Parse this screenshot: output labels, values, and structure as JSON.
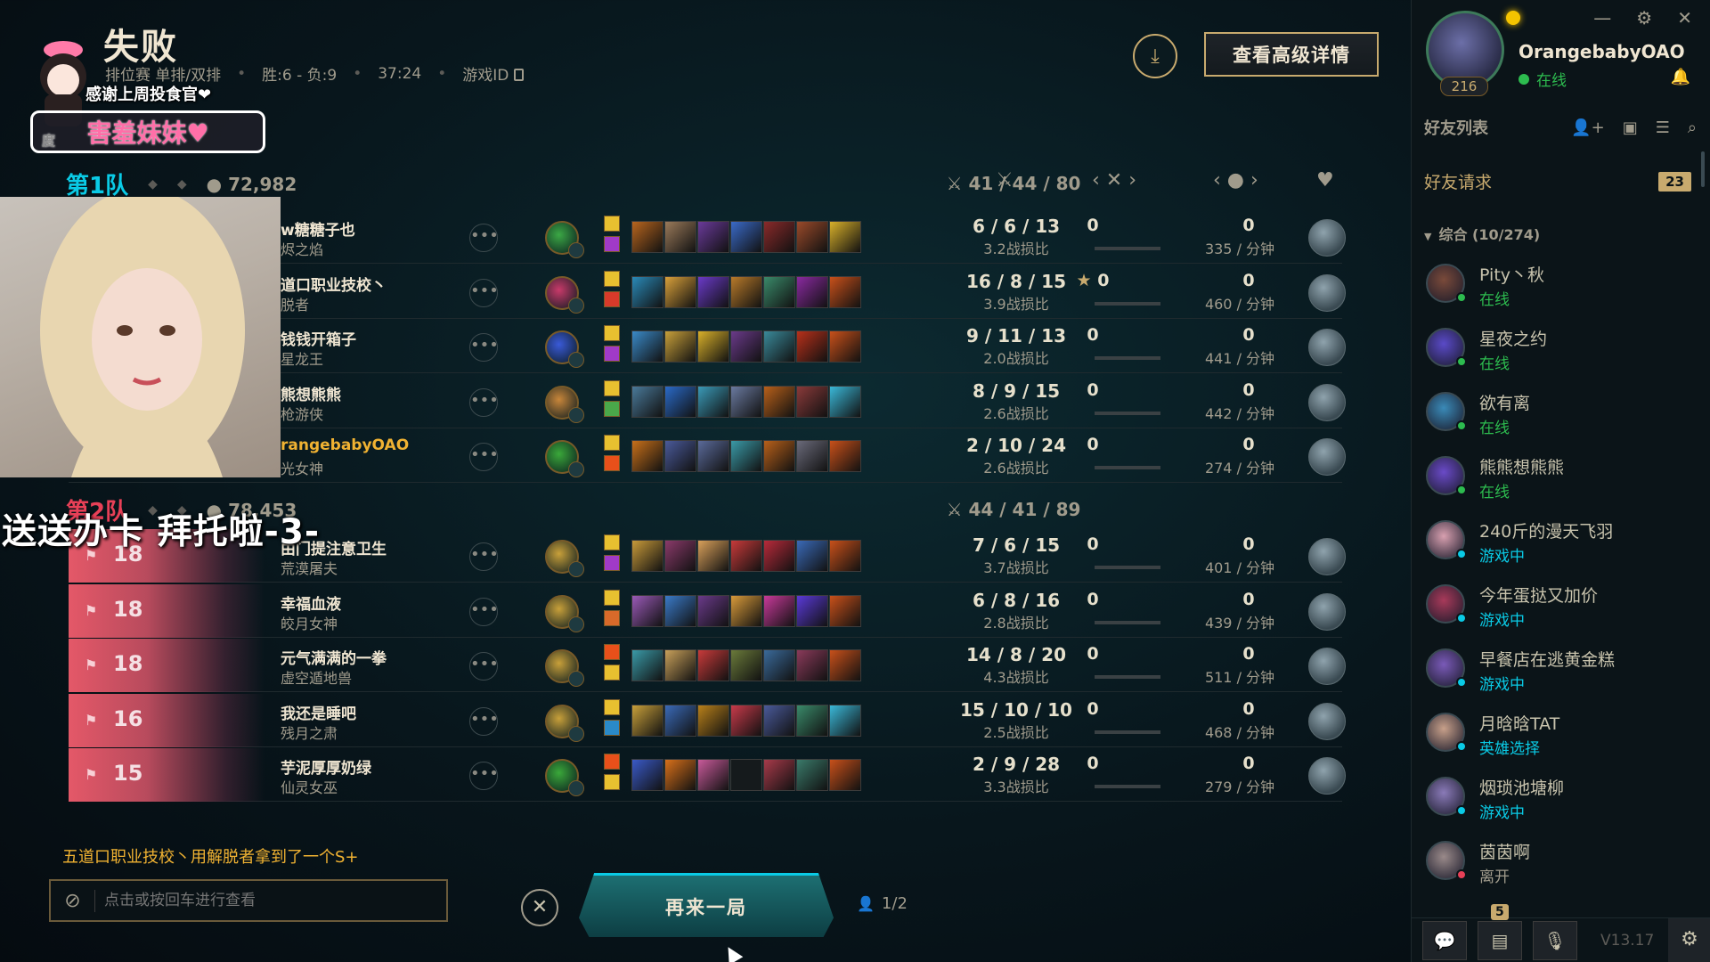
{
  "header": {
    "result": "失败",
    "mode": "排位赛 单排/双排",
    "record": "胜:6 - 负:9",
    "duration": "37:24",
    "game_id_label": "游戏ID",
    "advanced_button": "查看高级详情"
  },
  "overlay": {
    "thanks": "感谢上周投食官❤",
    "sister": "害羞妹妹♥",
    "sister_small": "度",
    "send_text": "送送办卡 拜托啦-3-"
  },
  "team1": {
    "name": "第1队",
    "kda": "41 / 44 / 80",
    "gold": "72,982",
    "players": [
      {
        "name": "w糖糖子也",
        "champ": "烬之焰",
        "kda": "6 / 6 / 13",
        "ratio": "3.2战损比",
        "score": "0",
        "star": "",
        "gold": "0",
        "gpm": "335 / 分钟",
        "me": false,
        "champ_color": "#3ba845",
        "items": [
          "#b8651e",
          "#9a7a5a",
          "#6a3a9a",
          "#3a6ac8",
          "#8a2a2a",
          "#9a4a2a",
          "#d8b02a"
        ],
        "spells": [
          "#e8c030",
          "#a03ac8"
        ]
      },
      {
        "name": "道口职业技校丶",
        "champ": "脱者",
        "kda": "16 / 8 / 15",
        "ratio": "3.9战损比",
        "score": "0",
        "star": "★",
        "gold": "0",
        "gpm": "460 / 分钟",
        "me": false,
        "champ_color": "#c83a6a",
        "items": [
          "#2a8ab8",
          "#d8a03a",
          "#6a3ac8",
          "#b87a2a",
          "#3a8a6a",
          "#8a2aa0",
          "#c8501a"
        ],
        "spells": [
          "#e8c030",
          "#d83a2a"
        ]
      },
      {
        "name": "钱钱开箱子",
        "champ": "星龙王",
        "kda": "9 / 11 / 13",
        "ratio": "2.0战损比",
        "score": "0",
        "star": "",
        "gold": "0",
        "gpm": "441 / 分钟",
        "me": false,
        "champ_color": "#3a5ad8",
        "items": [
          "#3a8ac8",
          "#c8a03a",
          "#d8b02a",
          "#6a3a8a",
          "#3a8a9a",
          "#b8301a",
          "#c8501a"
        ],
        "spells": [
          "#e8c030",
          "#a03ac8"
        ]
      },
      {
        "name": "熊想熊熊",
        "champ": "枪游侠",
        "kda": "8 / 9 / 15",
        "ratio": "2.6战损比",
        "score": "0",
        "star": "",
        "gold": "0",
        "gpm": "442 / 分钟",
        "me": false,
        "champ_color": "#c8863a",
        "items": [
          "#4a7a9a",
          "#2a6ac8",
          "#3a9ab8",
          "#6a7aa0",
          "#b8601a",
          "#8a3a3a",
          "#3ab8d8"
        ],
        "spells": [
          "#e8c030",
          "#4aa84a"
        ]
      },
      {
        "name": "rangebabyOAO",
        "champ": "光女神",
        "kda": "2 / 10 / 24",
        "ratio": "2.6战损比",
        "score": "0",
        "star": "",
        "gold": "0",
        "gpm": "274 / 分钟",
        "me": true,
        "champ_color": "#3aa83a",
        "items": [
          "#c8701a",
          "#4a5a9a",
          "#5a6a9a",
          "#3a9aa8",
          "#b8601a",
          "#6a6a7a",
          "#c8501a"
        ],
        "spells": [
          "#e8c030",
          "#e8501a"
        ]
      }
    ]
  },
  "team2": {
    "name": "第2队",
    "kda": "44 / 41 / 89",
    "gold": "78,453",
    "players": [
      {
        "name": "由门提注意卫生",
        "champ": "荒漠屠夫",
        "level": "18",
        "kda": "7 / 6 / 15",
        "ratio": "3.7战损比",
        "score": "0",
        "gold": "0",
        "gpm": "401 / 分钟",
        "champ_color": "#c8a03a",
        "items": [
          "#c89a3a",
          "#8a3a6a",
          "#d8a05a",
          "#c83a3a",
          "#b82a3a",
          "#3a6ab8",
          "#c8501a"
        ],
        "spells": [
          "#e8c030",
          "#a03ac8"
        ]
      },
      {
        "name": "幸福血液",
        "champ": "皎月女神",
        "level": "18",
        "kda": "6 / 8 / 16",
        "ratio": "2.8战损比",
        "score": "0",
        "gold": "0",
        "gpm": "439 / 分钟",
        "champ_color": "#c8a03a",
        "items": [
          "#9a5ab8",
          "#3a7ac8",
          "#6a3a8a",
          "#d89a3a",
          "#c83a9a",
          "#5a3ad8",
          "#c8501a"
        ],
        "spells": [
          "#e8c030",
          "#d86a2a"
        ]
      },
      {
        "name": "元气满满的一拳",
        "champ": "虚空遁地兽",
        "level": "18",
        "kda": "14 / 8 / 20",
        "ratio": "4.3战损比",
        "score": "0",
        "gold": "0",
        "gpm": "511 / 分钟",
        "champ_color": "#c8a03a",
        "items": [
          "#3a9aa8",
          "#c8a05a",
          "#c83a3a",
          "#6a7a3a",
          "#3a6a9a",
          "#8a3a5a",
          "#c8501a"
        ],
        "spells": [
          "#e8501a",
          "#e8c030"
        ]
      },
      {
        "name": "我还是睡吧",
        "champ": "残月之肃",
        "level": "16",
        "kda": "15 / 10 / 10",
        "ratio": "2.5战损比",
        "score": "0",
        "gold": "0",
        "gpm": "468 / 分钟",
        "champ_color": "#c8a03a",
        "items": [
          "#c8a03a",
          "#3a6ab8",
          "#b8801a",
          "#c83a4a",
          "#4a5a9a",
          "#3a8a6a",
          "#3ab8d8"
        ],
        "spells": [
          "#e8c030",
          "#2a8ac8"
        ]
      },
      {
        "name": "芋泥厚厚奶绿",
        "champ": "仙灵女巫",
        "level": "15",
        "kda": "2 / 9 / 28",
        "ratio": "3.3战损比",
        "score": "0",
        "gold": "0",
        "gpm": "279 / 分钟",
        "champ_color": "#3aa83a",
        "items": [
          "#3a5ac8",
          "#d8701a",
          "#c85a9a",
          "",
          "#a83a4a",
          "#3a7a6a",
          "#c8501a"
        ],
        "spells": [
          "#e8501a",
          "#e8c030"
        ]
      }
    ]
  },
  "bottom": {
    "s_plus_msg": "五道口职业技校丶用解脱者拿到了一个S+",
    "chat_placeholder": "点击或按回车进行查看",
    "play_again": "再来一局",
    "party": "1/2"
  },
  "social": {
    "username": "OrangebabyOAO",
    "level": "216",
    "status": "在线",
    "friend_list_label": "好友列表",
    "friend_requests_label": "好友请求",
    "friend_requests_count": "23",
    "group_label": "综合 (10/274)",
    "friends": [
      {
        "name": "Pity丶秋",
        "status": "在线",
        "kind": "online",
        "color": "#7a4a3a"
      },
      {
        "name": "星夜之约",
        "status": "在线",
        "kind": "online",
        "color": "#5a4ac8"
      },
      {
        "name": "欲有离",
        "status": "在线",
        "kind": "online",
        "color": "#3a8ab8"
      },
      {
        "name": "熊熊想熊熊",
        "status": "在线",
        "kind": "online",
        "color": "#6a4ac8"
      },
      {
        "name": "240斤的漫天飞羽",
        "status": "游戏中",
        "kind": "game",
        "color": "#d8a0b0"
      },
      {
        "name": "今年蛋挞又加价",
        "status": "游戏中",
        "kind": "game",
        "color": "#a83a5a"
      },
      {
        "name": "早餐店在逃黄金糕",
        "status": "游戏中",
        "kind": "game",
        "color": "#7a5ab8"
      },
      {
        "name": "月晗晗TAT",
        "status": "英雄选择",
        "kind": "game",
        "color": "#c8a08a"
      },
      {
        "name": "烟琐池塘柳",
        "status": "游戏中",
        "kind": "game",
        "color": "#8a7ab8"
      },
      {
        "name": "茵茵啊",
        "status": "离开",
        "kind": "away",
        "color": "#9a8a8a"
      }
    ],
    "notif_count": "5",
    "version": "V13.17"
  }
}
